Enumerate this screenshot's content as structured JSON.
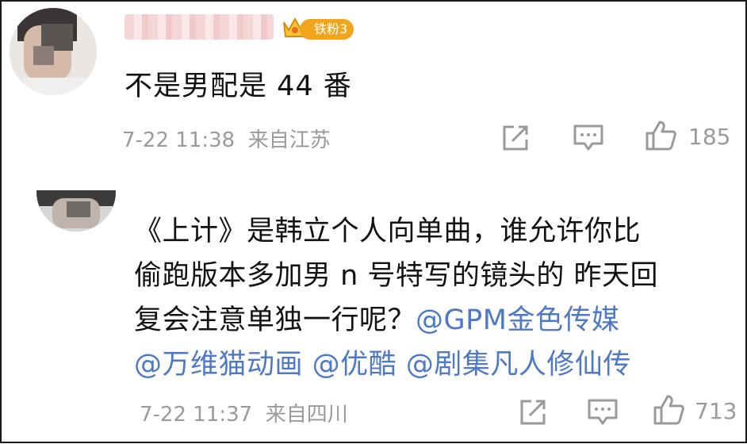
{
  "comments": [
    {
      "avatar_icon": "user-avatar-icon",
      "badge": "铁粉3",
      "text": "不是男配是 44 番",
      "time": "7-22 11:38",
      "location": "来自江苏",
      "likes": "185"
    },
    {
      "avatar_icon": "user-avatar-icon",
      "text_line1": "《上计》是韩立个人向单曲，谁允许你比",
      "text_line2": "偷跑版本多加男 n 号特写的镜头的 昨天回",
      "text_line3_plain": "复会注意单独一行呢？",
      "mention_gpm": "@GPM金色传媒",
      "mention_wanwei": "@万维猫动画",
      "mention_youku": "@优酷",
      "mention_drama": "@剧集凡人修仙传",
      "time": "7-22 11:37",
      "location": "来自四川",
      "likes": "713"
    }
  ],
  "colors": {
    "badge": "#f0a51c",
    "mention": "#4e79c7",
    "meta": "#9a9a9a",
    "border": "#1a1a1a"
  },
  "icons": {
    "share": "share-icon",
    "comment": "comment-icon",
    "like": "like-icon",
    "crown": "crown-icon"
  }
}
